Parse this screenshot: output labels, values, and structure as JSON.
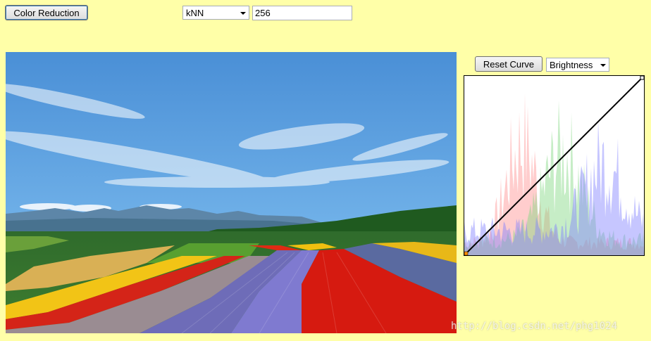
{
  "toolbar": {
    "color_reduction_label": "Color Reduction",
    "algorithm_selected": "kNN",
    "color_count_value": "256"
  },
  "curve_panel": {
    "reset_label": "Reset Curve",
    "channel_selected": "Brightness"
  },
  "watermark": "http://blog.csdn.net/phg1024",
  "colors": {
    "background": "#ffffa8",
    "histogram_red": "#ff9090",
    "histogram_green": "#80d880",
    "histogram_blue": "#8080ff"
  }
}
